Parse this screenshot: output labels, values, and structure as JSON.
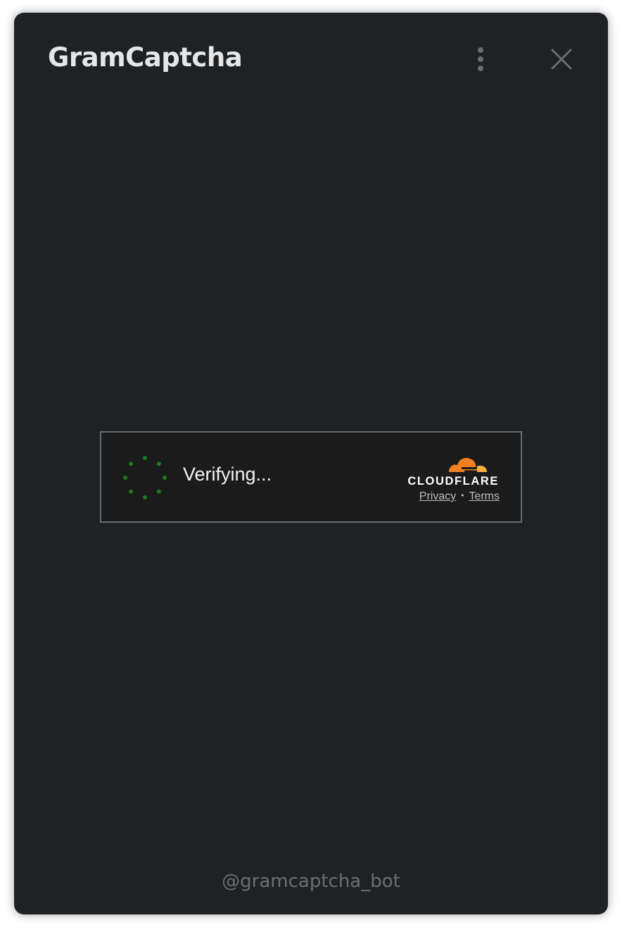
{
  "header": {
    "title": "GramCaptcha",
    "menu_icon": "more-vertical-icon",
    "close_icon": "close-icon"
  },
  "widget": {
    "status_text": "Verifying...",
    "spinner_icon": "loading-spinner-icon",
    "spinner_color": "#1f7a1f",
    "brand_text": "CLOUDFLARE",
    "brand_icon": "cloudflare-cloud-icon",
    "brand_colors": {
      "primary": "#f38020",
      "secondary": "#faae40"
    },
    "links": {
      "privacy": "Privacy",
      "separator": "•",
      "terms": "Terms"
    }
  },
  "footer": {
    "bot_handle": "@gramcaptcha_bot"
  },
  "colors": {
    "background": "#1f2225",
    "widget_background": "#1b1b1c",
    "widget_border": "#6a6a6a"
  }
}
